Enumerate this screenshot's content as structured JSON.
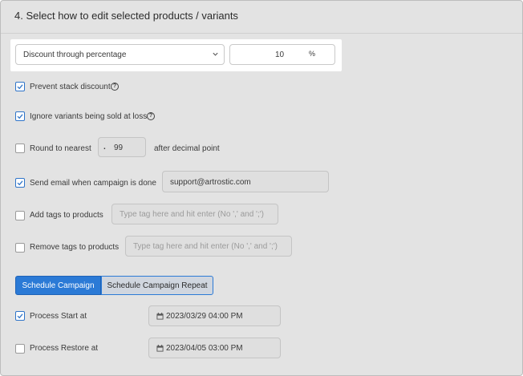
{
  "header": {
    "title": "4. Select how to edit selected products / variants"
  },
  "edit_method": {
    "selected": "Discount through percentage",
    "value": "10",
    "unit": "%"
  },
  "options": {
    "prevent_stack": {
      "label": "Prevent stack discount",
      "checked": true
    },
    "ignore_loss": {
      "label": "Ignore variants being sold at loss",
      "checked": true
    },
    "round": {
      "label": "Round to nearest",
      "prefix": ".",
      "value": "99",
      "suffix": "after decimal point",
      "checked": false
    },
    "send_email": {
      "label": "Send email when campaign is done",
      "value": "support@artrostic.com",
      "checked": true
    },
    "add_tags": {
      "label": "Add tags to products",
      "placeholder": "Type tag here and hit enter (No ',' and ';')",
      "checked": false
    },
    "remove_tags": {
      "label": "Remove tags to products",
      "placeholder": "Type tag here and hit enter (No ',' and ';')",
      "checked": false
    }
  },
  "schedule": {
    "tab_campaign": "Schedule Campaign",
    "tab_repeat": "Schedule Campaign Repeat",
    "start": {
      "label": "Process Start at",
      "value": "2023/03/29 04:00 PM",
      "checked": true
    },
    "restore": {
      "label": "Process Restore at",
      "value": "2023/04/05 03:00 PM",
      "checked": false
    }
  },
  "colors": {
    "accent": "#2b7ad6",
    "panel": "#e3e3e3"
  },
  "icons": {
    "select": "chevron-down-icon",
    "help": "help-icon",
    "date": "calendar-icon",
    "check": "checkmark-icon"
  }
}
